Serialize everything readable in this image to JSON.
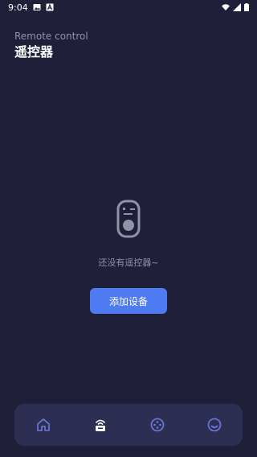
{
  "status_bar": {
    "time": "9:04",
    "icons": [
      "image-notification-icon",
      "a-notification-icon",
      "wifi-icon",
      "signal-icon",
      "battery-icon"
    ]
  },
  "header": {
    "subtitle": "Remote control",
    "title": "遥控器"
  },
  "empty_state": {
    "icon": "remote-icon",
    "message": "还没有遥控器~"
  },
  "add_button": {
    "label": "添加设备"
  },
  "tabbar": {
    "tabs": [
      {
        "icon": "home-icon",
        "active": false
      },
      {
        "icon": "remote-tab-icon",
        "active": true
      },
      {
        "icon": "gamepad-icon",
        "active": false
      },
      {
        "icon": "smiley-icon",
        "active": false
      }
    ]
  },
  "colors": {
    "background": "#1f1f3a",
    "accent": "#4e7bf2",
    "tabbar_bg": "#2c2f52",
    "muted_text": "#8e93a8",
    "inactive_tab": "#6d7ce0"
  }
}
